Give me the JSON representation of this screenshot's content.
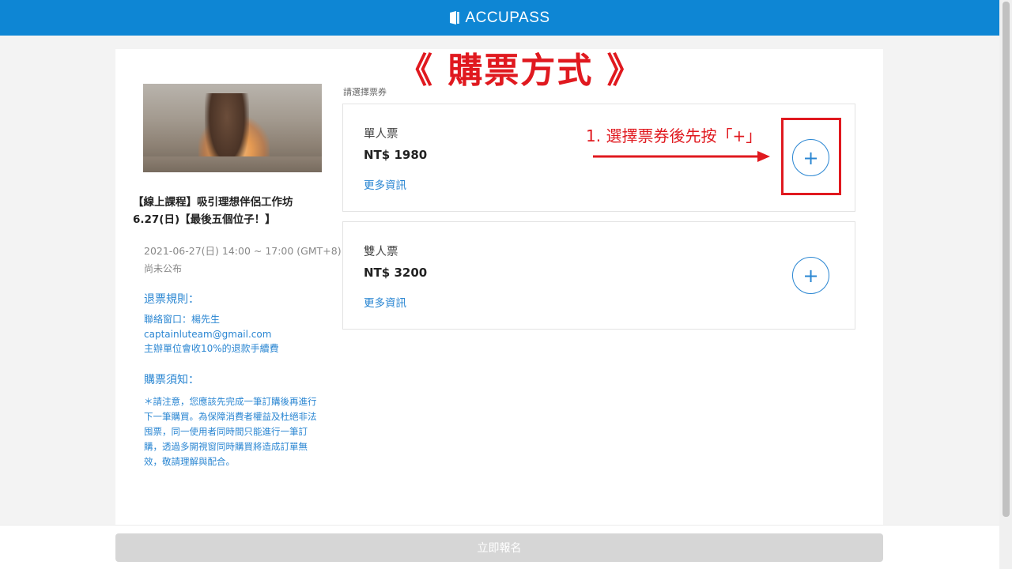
{
  "header": {
    "brand": "ACCUPASS"
  },
  "event": {
    "title": "【線上課程】吸引理想伴侶工作坊 6.27(日)【最後五個位子！】",
    "datetime": "2021-06-27(日) 14:00 ~ 17:00 (GMT+8)",
    "venue": "尚未公布"
  },
  "refund": {
    "heading": "退票規則：",
    "contact": "聯絡窗口：楊先生",
    "email": "captainluteam@gmail.com",
    "fee": "主辦單位會收10%的退款手續費"
  },
  "notice": {
    "heading": "購票須知：",
    "body": "＊請注意，您應該先完成一筆訂購後再進行下一筆購買。為保障消費者權益及杜絕非法囤票，同一使用者同時間只能進行一筆訂購，透過多開視窗同時購買將造成訂單無效，敬請理解與配合。"
  },
  "tickets": {
    "section_label": "請選擇票券",
    "items": [
      {
        "name": "單人票",
        "price": "NT$ 1980",
        "more": "更多資訊",
        "add": "+"
      },
      {
        "name": "雙人票",
        "price": "NT$ 3200",
        "more": "更多資訊",
        "add": "+"
      }
    ]
  },
  "annotation": {
    "title": "《 購票方式 》",
    "step1": "1. 選擇票券後先按「+」",
    "color": "#e0191f"
  },
  "footer": {
    "register_label": "立即報名"
  },
  "colors": {
    "brand": "#0e86d4",
    "link": "#2a86d2",
    "disabled_button": "#d6d6d6"
  }
}
